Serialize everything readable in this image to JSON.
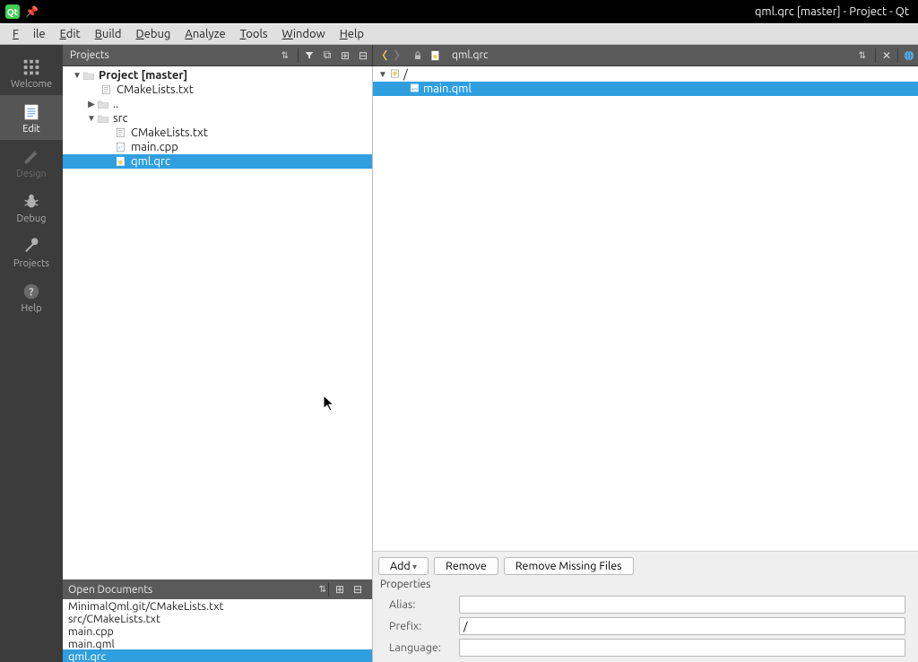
{
  "titlebar": {
    "title": "qml.qrc [master] - Project - Qt"
  },
  "menu": {
    "file": "File",
    "edit": "Edit",
    "build": "Build",
    "debug": "Debug",
    "analyze": "Analyze",
    "tools": "Tools",
    "window": "Window",
    "help": "Help"
  },
  "sidebar": {
    "items": [
      {
        "id": "welcome",
        "label": "Welcome"
      },
      {
        "id": "edit",
        "label": "Edit"
      },
      {
        "id": "design",
        "label": "Design"
      },
      {
        "id": "debug",
        "label": "Debug"
      },
      {
        "id": "projects",
        "label": "Projects"
      },
      {
        "id": "help",
        "label": "Help"
      }
    ]
  },
  "projectsCombo": {
    "label": "Projects"
  },
  "openFileCombo": {
    "label": "qml.qrc"
  },
  "tree": {
    "root": {
      "label": "Project [master]"
    },
    "cmakelists": "CMakeLists.txt",
    "dotdot": "..",
    "src": "src",
    "src_cmake": "CMakeLists.txt",
    "main_cpp": "main.cpp",
    "qml_qrc": "qml.qrc"
  },
  "resourceTree": {
    "root": "/",
    "main_qml": "main.qml"
  },
  "openDocs": {
    "title": "Open Documents",
    "items": [
      "MinimalQml.git/CMakeLists.txt",
      "src/CMakeLists.txt",
      "main.cpp",
      "main.qml",
      "qml.qrc"
    ],
    "selected": "qml.qrc"
  },
  "buttons": {
    "add": "Add",
    "remove": "Remove",
    "removeMissing": "Remove Missing Files"
  },
  "properties": {
    "heading": "Properties",
    "alias_label": "Alias:",
    "alias_value": "",
    "prefix_label": "Prefix:",
    "prefix_value": "/",
    "language_label": "Language:",
    "language_value": ""
  }
}
